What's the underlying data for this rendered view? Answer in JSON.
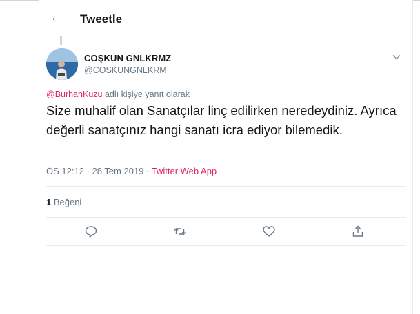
{
  "header": {
    "back_icon": "arrow-left-icon",
    "title": "Tweetle"
  },
  "tweet": {
    "author": {
      "name": "COŞKUN GNLKRMZ",
      "handle": "@COSKUNGNLKRM"
    },
    "reply_to": {
      "mention": "@BurhanKuzu",
      "suffix": " adlı kişiye yanıt olarak"
    },
    "text": "Size muhalif olan Sanatçılar linç edilirken neredeydiniz. Ayrıca değerli sanatçınız hangi sanatı icra ediyor bilemedik.",
    "time": "ÖS 12:12 · 28 Tem 2019 · ",
    "source": "Twitter Web App",
    "likes_count": "1",
    "likes_label": " Beğeni"
  },
  "actions": {
    "reply_icon": "reply-icon",
    "retweet_icon": "retweet-icon",
    "like_icon": "heart-icon",
    "share_icon": "share-icon"
  },
  "colors": {
    "accent": "#e0245e",
    "muted": "#657786",
    "text": "#14171a"
  }
}
